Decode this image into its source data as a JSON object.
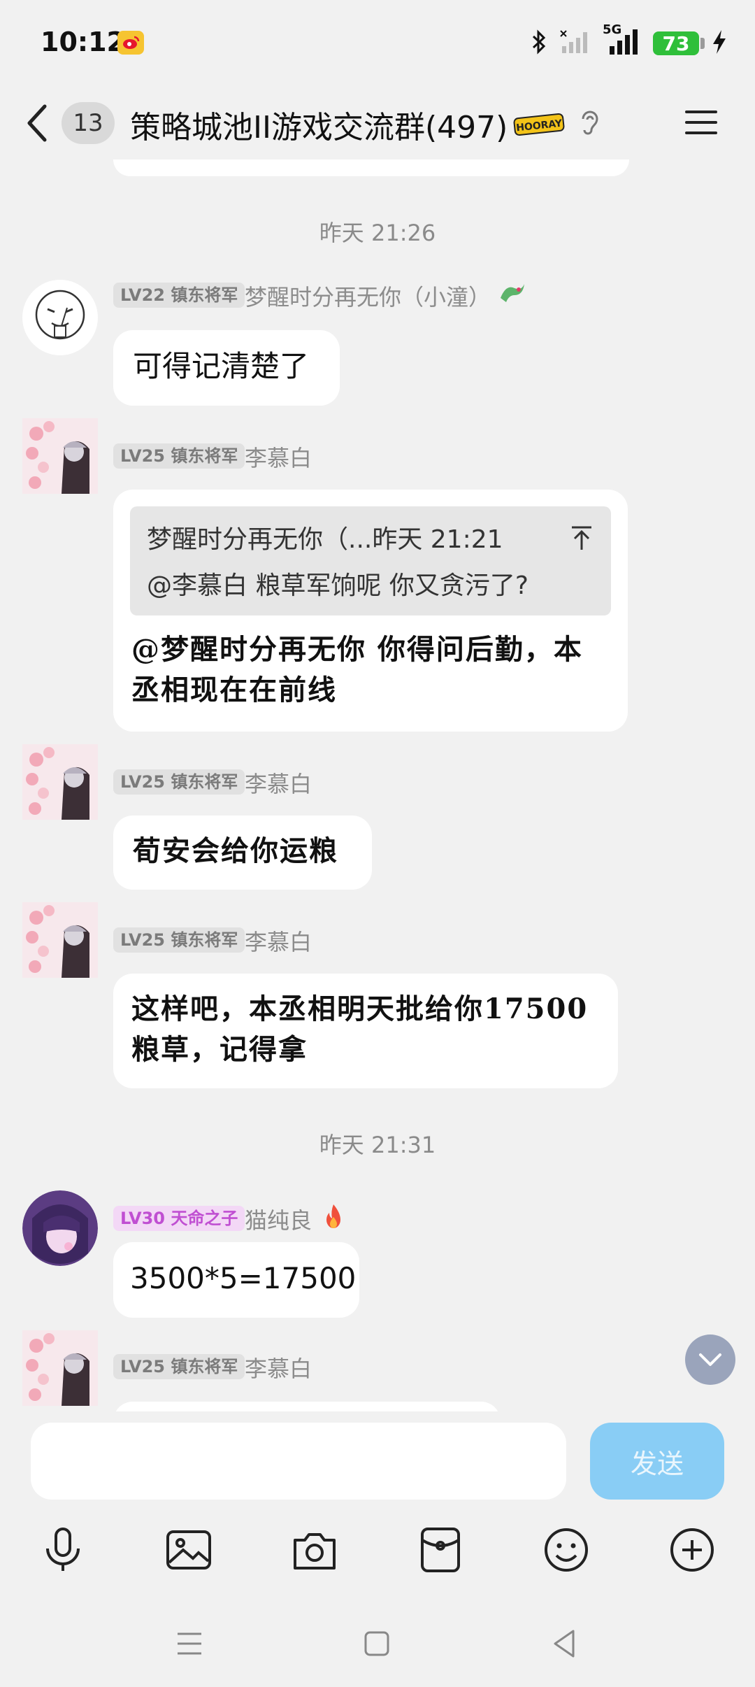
{
  "status_bar": {
    "time": "10:12",
    "network": "5G",
    "battery": "73"
  },
  "header": {
    "unread_count": "13",
    "title": "策略城池II游戏交流群(497)",
    "badge_text": "HOORAY"
  },
  "messages": {
    "ts1": "昨天 21:26",
    "m1": {
      "level": "LV22 镇东将军",
      "name": "梦醒时分再无你（小潼）",
      "text": "可得记清楚了"
    },
    "m2": {
      "level": "LV25 镇东将军",
      "name": "李慕白",
      "quote_line1": "梦醒时分再无你（...昨天 21:21",
      "quote_line2": "@李慕白 粮草军饷呢 你又贪污了?",
      "text_line1": "@梦醒时分再无你 你得问后勤，本",
      "text_line2": "丞相现在在前线"
    },
    "m3": {
      "level": "LV25 镇东将军",
      "name": "李慕白",
      "text": "荀安会给你运粮"
    },
    "m4": {
      "level": "LV25 镇东将军",
      "name": "李慕白",
      "text_line1": "这样吧，本丞相明天批给你17500",
      "text_line2": "粮草，记得拿"
    },
    "ts2": "昨天 21:31",
    "m5": {
      "level": "LV30 天命之子",
      "name": "猫纯良",
      "text": "3500*5=17500"
    },
    "m6": {
      "level": "LV25 镇东将军",
      "name": "李慕白"
    }
  },
  "input": {
    "placeholder": "",
    "send_label": "发送"
  },
  "toolbar": {
    "icons": [
      "microphone-icon",
      "image-icon",
      "camera-icon",
      "red-packet-icon",
      "emoji-icon",
      "plus-icon"
    ]
  },
  "colors": {
    "send_button": "#89cdf5",
    "battery": "#2fbf3a",
    "level_purple": "#c04fd2"
  }
}
